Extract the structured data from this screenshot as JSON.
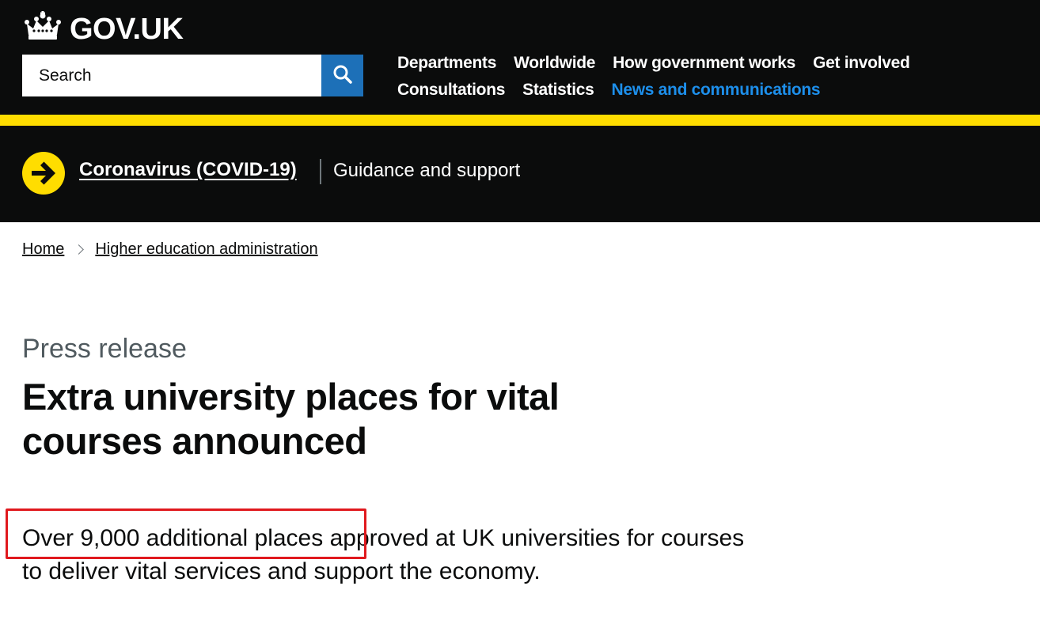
{
  "header": {
    "logo_text": "GOV.UK",
    "logo_icon": "crown-icon",
    "search": {
      "placeholder": "Search",
      "icon": "search-icon"
    },
    "nav": {
      "row1": [
        "Departments",
        "Worldwide",
        "How government works",
        "Get involved"
      ],
      "row2": [
        "Consultations",
        "Statistics",
        "News and communications"
      ],
      "active": "News and communications"
    },
    "colors": {
      "background": "#0b0c0c",
      "accent_bar": "#ffdd00",
      "search_button": "#1d70b8",
      "active_link": "#1d8feb"
    }
  },
  "covid_banner": {
    "icon": "arrow-right-icon",
    "link": "Coronavirus (COVID-19)",
    "text": "Guidance and support"
  },
  "breadcrumb": [
    "Home",
    "Higher education administration"
  ],
  "article": {
    "caption": "Press release",
    "title": "Extra university places for vital courses announced",
    "lead": "Over 9,000 additional places approved at UK universities for courses to deliver vital services and support the economy.",
    "highlight_color": "#e0191e"
  }
}
